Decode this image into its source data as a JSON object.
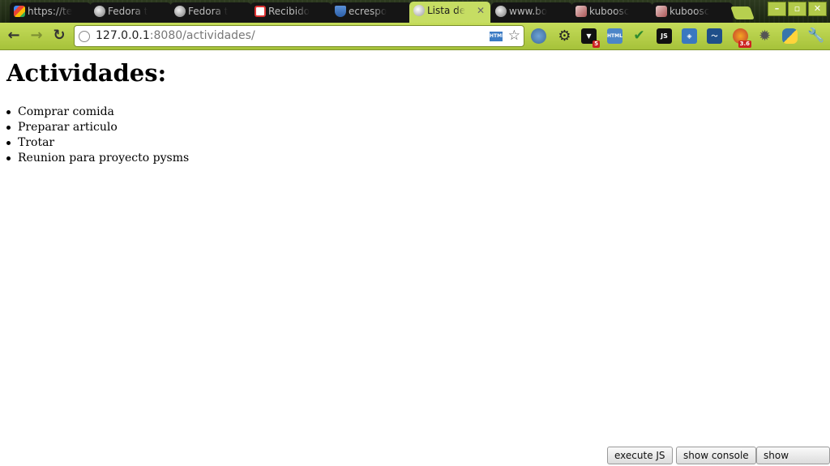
{
  "tabs": [
    {
      "label": "https://te",
      "icon": "google-icon",
      "active": false
    },
    {
      "label": "Fedora t",
      "icon": "globe-icon",
      "active": false
    },
    {
      "label": "Fedora t",
      "icon": "globe-icon",
      "active": false
    },
    {
      "label": "Recibido",
      "icon": "gmail-icon",
      "active": false
    },
    {
      "label": "ecrespo",
      "icon": "shield-icon",
      "active": false
    },
    {
      "label": "Lista de",
      "icon": "globe-icon",
      "active": true
    },
    {
      "label": "www.bo",
      "icon": "globe-icon",
      "active": false
    },
    {
      "label": "kuboosc",
      "icon": "image-icon",
      "active": false
    },
    {
      "label": "kuboosc",
      "icon": "image-icon",
      "active": false
    }
  ],
  "toolbar": {
    "url_host": "127.0.0.1",
    "url_rest": ":8080/actividades/",
    "extension_badge_5": "5",
    "extension_badge_36": "3.6",
    "js_label": "JS"
  },
  "page": {
    "heading": "Actividades:",
    "items": [
      "Comprar comida",
      "Preparar articulo",
      "Trotar",
      "Reunion para proyecto pysms"
    ]
  },
  "debug_buttons": {
    "execute_js": "execute JS",
    "show_console": "show console",
    "show_source": "show source"
  },
  "colors": {
    "theme_green": "#c6dd63",
    "tab_dark": "#151515"
  }
}
